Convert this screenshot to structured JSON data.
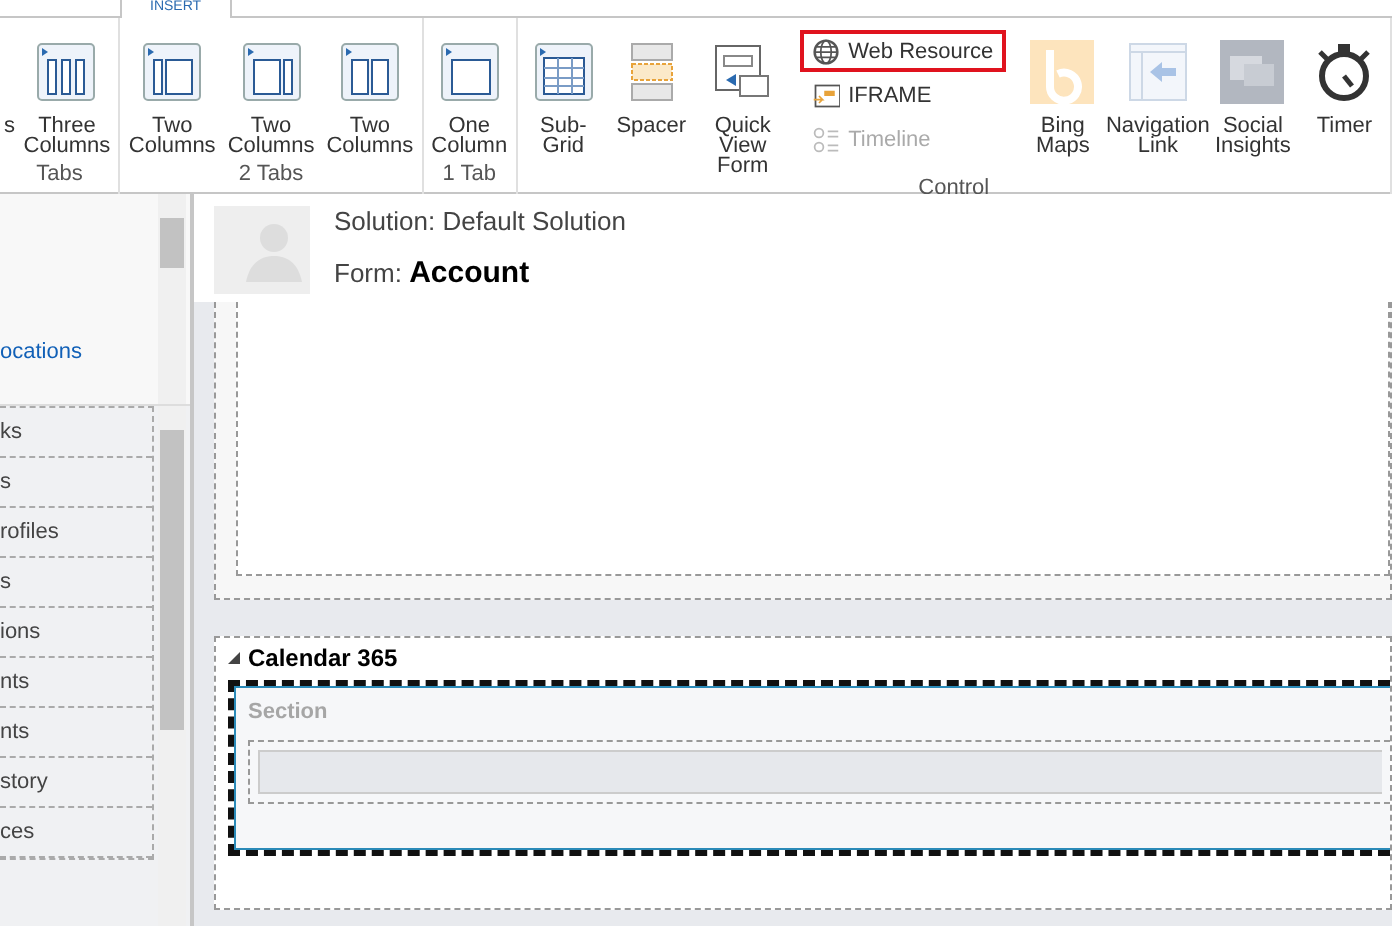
{
  "ribbon": {
    "tabs": [
      {
        "label": "INSERT",
        "selected": true
      }
    ],
    "groups": [
      {
        "label": "Tabs",
        "buttons": [
          {
            "kind": "fragment",
            "label": "s"
          },
          {
            "kind": "large",
            "label": "Three Columns"
          }
        ]
      },
      {
        "label": "2 Tabs",
        "buttons": [
          {
            "kind": "large",
            "label": "Two Columns"
          },
          {
            "kind": "large",
            "label": "Two Columns"
          },
          {
            "kind": "large",
            "label": "Two Columns"
          }
        ]
      },
      {
        "label": "1 Tab",
        "buttons": [
          {
            "kind": "large",
            "label": "One Column"
          }
        ]
      },
      {
        "label": "Control",
        "buttons": [
          {
            "kind": "large",
            "label": "Sub-Grid"
          },
          {
            "kind": "large",
            "label": "Spacer"
          },
          {
            "kind": "large",
            "label": "Quick View Form"
          },
          {
            "kind": "stack",
            "items": [
              {
                "label": "Web Resource",
                "highlighted": true,
                "disabled": false
              },
              {
                "label": "IFRAME",
                "highlighted": false,
                "disabled": false
              },
              {
                "label": "Timeline",
                "highlighted": false,
                "disabled": true
              }
            ]
          },
          {
            "kind": "large",
            "label": "Bing Maps"
          },
          {
            "kind": "large",
            "label": "Navigation Link"
          },
          {
            "kind": "large",
            "label": "Social Insights"
          },
          {
            "kind": "large",
            "label": "Timer"
          }
        ]
      }
    ]
  },
  "navigation": {
    "links": [
      "ocations"
    ],
    "items": [
      "ks",
      "s",
      "rofiles",
      "s",
      "ions",
      "nts",
      "nts",
      "story",
      "ces"
    ]
  },
  "form": {
    "solution": "Solution: Default Solution",
    "title": "Form: **Account**",
    "tab": "Calendar 365",
    "section": "Section"
  }
}
